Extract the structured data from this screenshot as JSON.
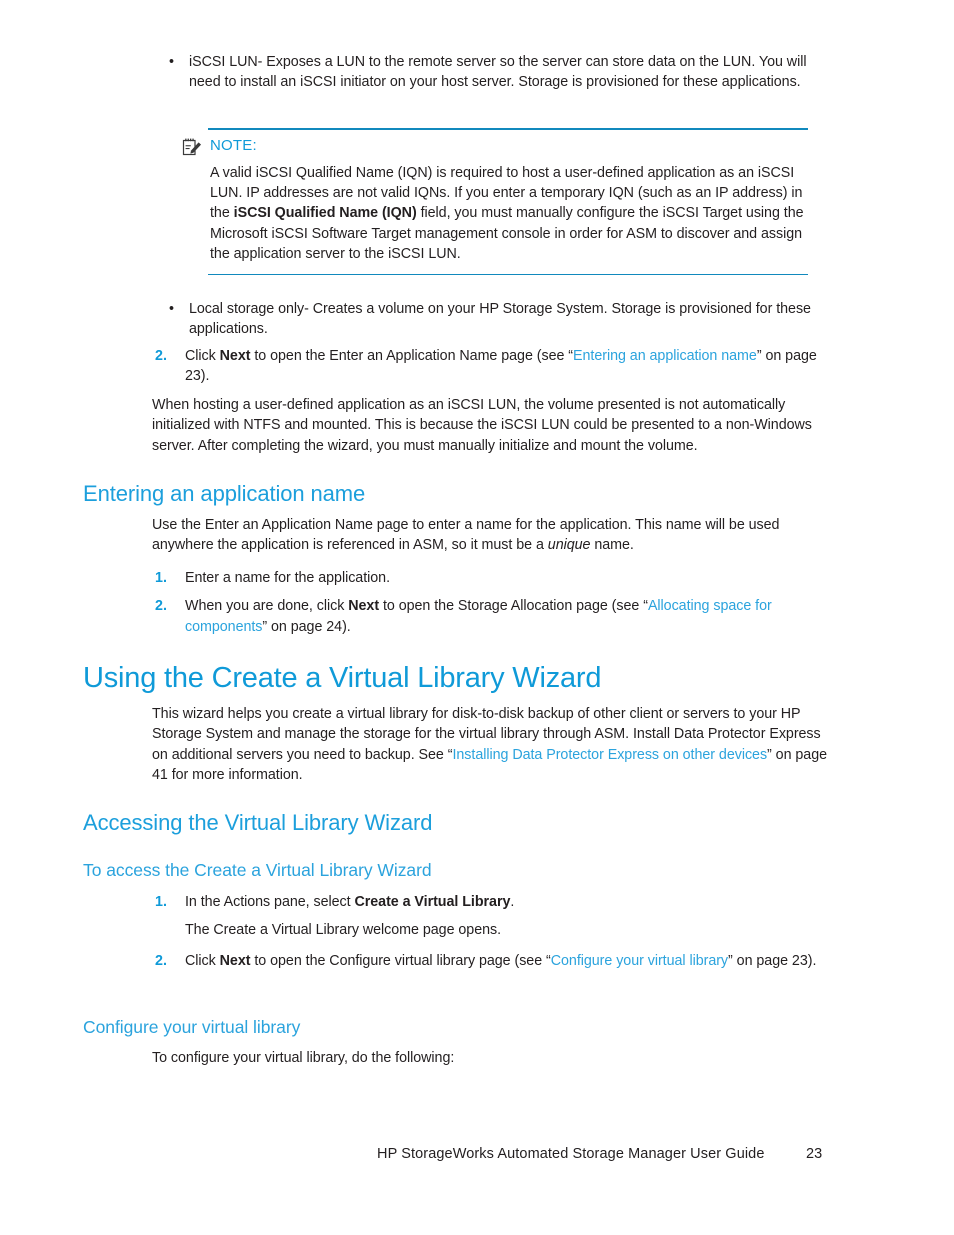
{
  "document": {
    "page_number": "23",
    "footer_title": "HP StorageWorks Automated Storage Manager User Guide"
  },
  "colors": {
    "heading_blue": "#0f9ad8",
    "link_blue": "#2ba3dd",
    "rule_blue": "#1189bd",
    "body_black": "#231f20"
  },
  "bullets": {
    "iscsi_lun": {
      "marker": "•",
      "text": "iSCSI LUN- Exposes a LUN to the remote server so the server can store data on the LUN. You will need to install an iSCSI initiator on your host server. Storage is provisioned for these applications."
    },
    "local_storage": {
      "marker": "•",
      "text": "Local storage only- Creates a volume on your HP Storage System. Storage is provisioned for these applications."
    }
  },
  "note": {
    "icon": "note-pencil-icon",
    "label": "NOTE:",
    "text_part1": "A valid iSCSI Qualified Name (IQN) is required to host a user-defined application as an iSCSI LUN. IP addresses are not valid IQNs. If you enter a temporary IQN (such as an IP address) in the ",
    "text_bold": "iSCSI Qualified Name (IQN)",
    "text_part2": " field, you must manually configure the iSCSI Target using the Microsoft iSCSI Software Target management console in order for ASM to discover and assign the application server to the iSCSI LUN."
  },
  "step_click_next_app_name": {
    "number": "2.",
    "text_pre": "Click ",
    "text_bold": "Next",
    "text_mid": " to open the Enter an Application Name page (see “",
    "link": "Entering an application name",
    "text_post": "” on page 23)."
  },
  "paragraph_hosting": {
    "text": "When hosting a user-defined application as an iSCSI LUN, the volume presented is not automatically initialized with NTFS and mounted. This is because the iSCSI LUN could be presented to a non-Windows server. After completing the wizard, you must manually initialize and mount the volume."
  },
  "section_entering_app_name": {
    "heading": "Entering an application name",
    "intro_pre": "Use the Enter an Application Name page to enter a name for the application. This name will be used anywhere the application is referenced in ASM, so it must be a ",
    "intro_italic": "unique",
    "intro_post": " name.",
    "steps": [
      {
        "number": "1.",
        "text": "Enter a name for the application."
      },
      {
        "number": "2.",
        "text_pre": "When you are done, click ",
        "text_bold": "Next",
        "text_mid": " to open the Storage Allocation page (see “",
        "link": "Allocating space for components",
        "text_post": "” on page 24)."
      }
    ]
  },
  "section_using_wizard": {
    "heading": "Using the Create a Virtual Library Wizard",
    "intro_pre": "This wizard helps you create a virtual library for disk-to-disk backup of other client or servers to your HP Storage System and manage the storage for the virtual library through ASM. Install Data Protector Express on additional servers you need to backup. See “",
    "link": "Installing Data Protector Express on other devices",
    "intro_post": "” on page 41 for more information."
  },
  "section_accessing_wizard": {
    "heading": "Accessing the Virtual Library Wizard",
    "subheading": "To access the Create a Virtual Library Wizard",
    "steps": [
      {
        "number": "1.",
        "text_pre": "In the Actions pane, select ",
        "text_bold": "Create a Virtual Library",
        "text_post": "."
      },
      {
        "note_text": "The Create a Virtual Library welcome page opens."
      },
      {
        "number": "2.",
        "text_pre": "Click ",
        "text_bold": "Next",
        "text_mid": " to open the Configure virtual library page (see “",
        "link": "Configure your virtual library",
        "text_post": "” on page 23)."
      }
    ]
  },
  "section_configure_library": {
    "heading": "Configure your virtual library",
    "intro": "To configure your virtual library, do the following:"
  }
}
